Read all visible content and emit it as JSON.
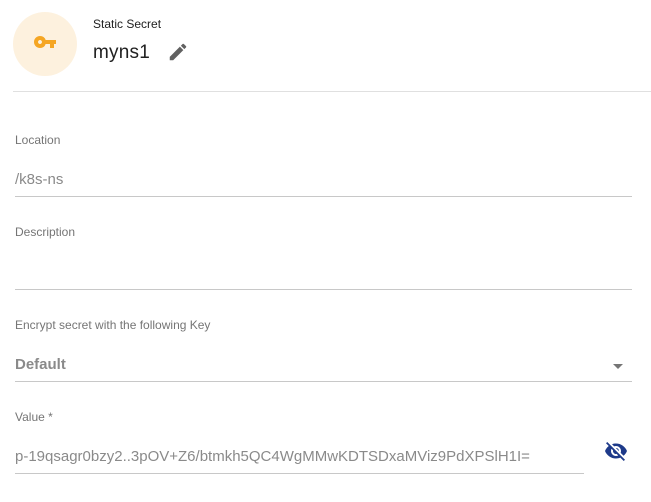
{
  "header": {
    "type_label": "Static Secret",
    "name": "myns1",
    "avatar_icon": "key-icon",
    "edit_icon": "pencil-icon",
    "accent_color": "#f5a623"
  },
  "fields": {
    "location": {
      "label": "Location",
      "value": "/k8s-ns"
    },
    "description": {
      "label": "Description",
      "value": ""
    },
    "encryption_key": {
      "label": "Encrypt secret with the following Key",
      "selected": "Default"
    },
    "value": {
      "label": "Value *",
      "value": "p-19qsagr0bzy2..3pOV+Z6/btmkh5QC4WgMMwKDTSDxaMViz9PdXPSlH1I=",
      "visibility_icon": "eye-off-icon",
      "visibility_icon_color": "#1e3a8a"
    }
  }
}
